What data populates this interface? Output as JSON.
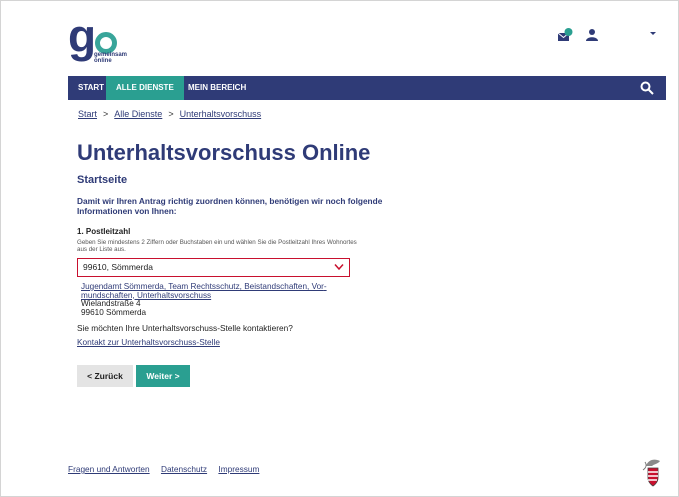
{
  "logo": {
    "text": "g",
    "sub_line1": "gemeinsam",
    "sub_line2": "online"
  },
  "header": {
    "icons": [
      "mail-notification-icon",
      "user-icon",
      "chevron-down-icon"
    ],
    "badge_color": "#2a9f91"
  },
  "nav": {
    "items": [
      {
        "label": "START"
      },
      {
        "label": "ALLE DIENSTE",
        "active": true
      },
      {
        "label": "MEIN BEREICH"
      }
    ],
    "search_icon": "search-icon"
  },
  "breadcrumb": {
    "items": [
      "Start",
      "Alle Dienste",
      "Unterhaltsvorschuss"
    ],
    "separator": ">"
  },
  "page": {
    "title": "Unterhaltsvorschuss Online",
    "subtitle": "Startseite",
    "intro": "Damit wir Ihren Antrag richtig zuordnen können, benötigen wir noch folgende Informationen von Ihnen:",
    "section_label": "1. Postleitzahl",
    "hint": "Geben Sie mindestens 2 Ziffern oder Buchstaben ein und wählen Sie die Post­leitzahl Ihres Wohnortes aus der Liste aus.",
    "select_value": "99610, Sömmerda"
  },
  "office": {
    "name": "Jugendamt Sömmerda, Team Rechtsschutz, Beistandschaften, Vor­mundschaften, Unterhaltsvorschuss",
    "street": "Wielandstraße 4",
    "city": "99610 Sömmerda"
  },
  "contact": {
    "question": "Sie möchten Ihre Unterhaltsvorschuss-Stelle kontaktieren?",
    "link": "Kontakt zur Unterhaltsvorschuss-Stelle"
  },
  "buttons": {
    "back": "< Zurück",
    "next": "Weiter >"
  },
  "footer": {
    "links": [
      "Fragen und Antworten",
      "Datenschutz",
      "Impressum"
    ]
  },
  "colors": {
    "primary": "#2f3b77",
    "accent": "#2a9f91",
    "error": "#c8102e"
  }
}
